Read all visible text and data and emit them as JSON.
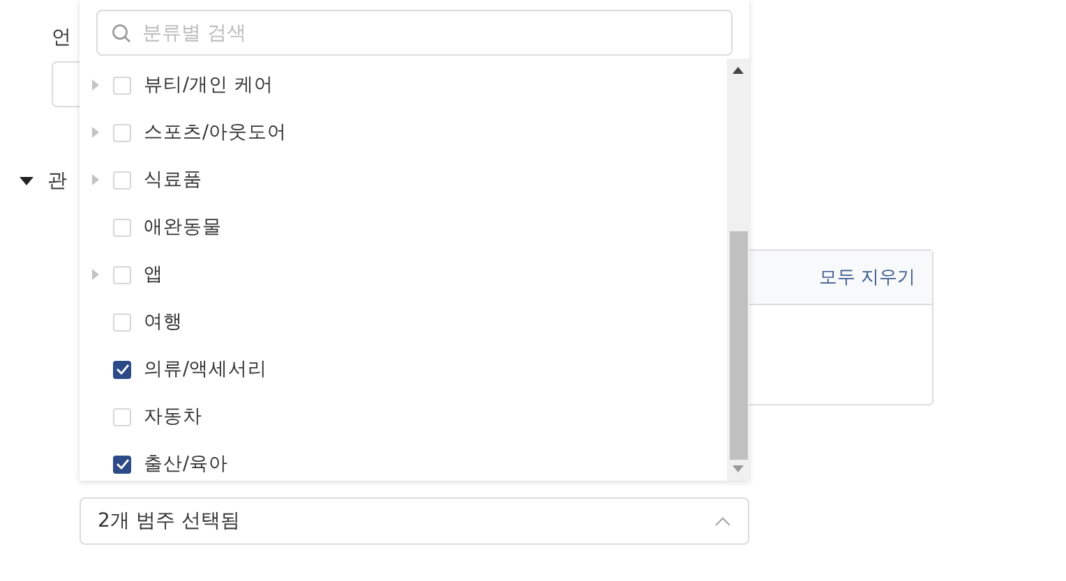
{
  "language_label": "언",
  "interest_section": {
    "label": "관",
    "expanded": true,
    "clear_all": "모두 지우기"
  },
  "category_dropdown": {
    "search": {
      "placeholder": "분류별 검색"
    },
    "items": [
      {
        "label": "뷰티/개인 케어",
        "expandable": true,
        "checked": false
      },
      {
        "label": "스포츠/아웃도어",
        "expandable": true,
        "checked": false
      },
      {
        "label": "식료품",
        "expandable": true,
        "checked": false
      },
      {
        "label": "애완동물",
        "expandable": false,
        "checked": false
      },
      {
        "label": "앱",
        "expandable": true,
        "checked": false
      },
      {
        "label": "여행",
        "expandable": false,
        "checked": false
      },
      {
        "label": "의류/액세서리",
        "expandable": false,
        "checked": true
      },
      {
        "label": "자동차",
        "expandable": false,
        "checked": false
      },
      {
        "label": "출산/육아",
        "expandable": false,
        "checked": true
      }
    ],
    "summary": "2개 범주 선택됨",
    "expanded": true
  }
}
